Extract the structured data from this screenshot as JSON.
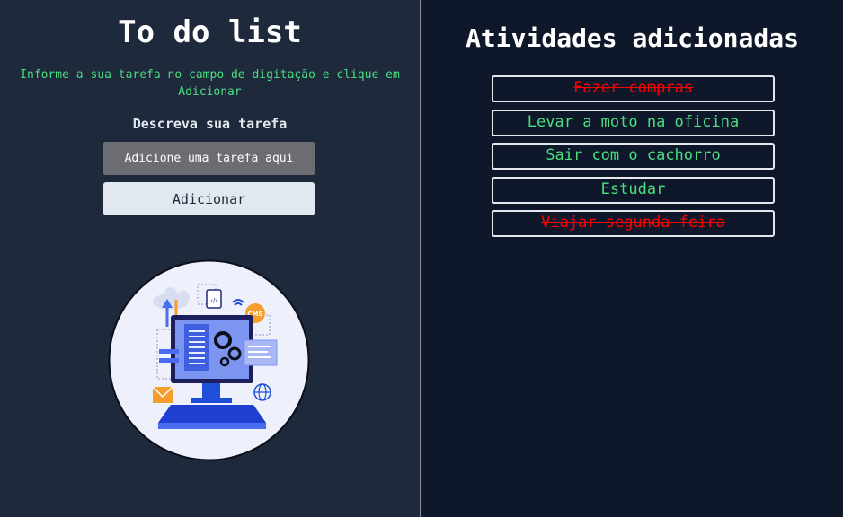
{
  "left": {
    "title": "To do list",
    "instruction": "Informe a sua tarefa no campo de digitação e clique em Adicionar",
    "input_label": "Descreva sua tarefa",
    "input_placeholder": "Adicione uma tarefa aqui",
    "input_value": "",
    "add_button_label": "Adicionar"
  },
  "right": {
    "title": "Atividades adicionadas",
    "tasks": [
      {
        "text": "Fazer compras",
        "done": true
      },
      {
        "text": "Levar a moto na oficina",
        "done": false
      },
      {
        "text": "Sair com o cachorro",
        "done": false
      },
      {
        "text": "Estudar",
        "done": false
      },
      {
        "text": "Viajar segunda feira",
        "done": true
      }
    ]
  },
  "colors": {
    "left_bg": "#1e293b",
    "right_bg": "#0f172a",
    "accent_green": "#4ade80",
    "done_red": "#ff0000"
  },
  "icons": [
    "computer-dev-illustration"
  ]
}
